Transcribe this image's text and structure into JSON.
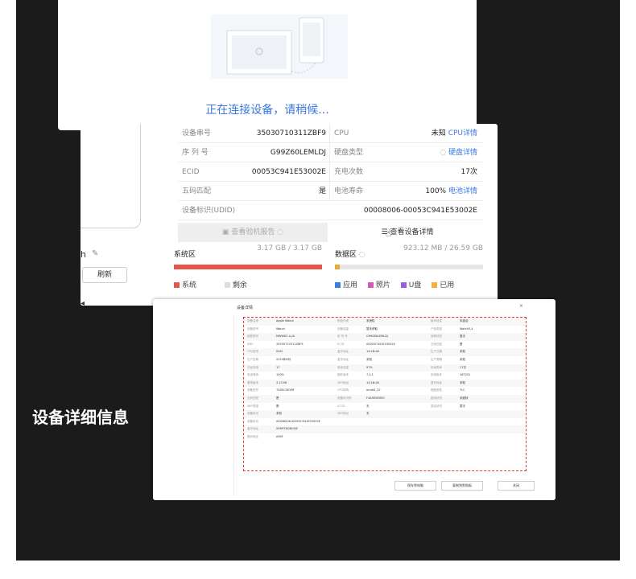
{
  "connect": {
    "text": "正在连接设备，请稍候..."
  },
  "info": {
    "rows": [
      {
        "k1": "设备串号",
        "v1": "35030710311ZBF9",
        "k2": "CPU",
        "v2": "未知",
        "v2_link": "CPU详情"
      },
      {
        "k1": "序 列 号",
        "v1": "G99Z60LEMLDJ",
        "k2": "硬盘类型",
        "v2": "",
        "v2_link": "硬盘详情"
      },
      {
        "k1": "ECID",
        "v1": "00053C941E53002E",
        "k2": "充电次数",
        "v2": "17次",
        "v2_link": ""
      },
      {
        "k1": "五码匹配",
        "v1": "是",
        "k2": "电池寿命",
        "v2": "100%",
        "v2_link": "电池详情"
      }
    ],
    "udid_label": "设备标识(UDID)",
    "udid_value": "00008006-00053C941E53002E",
    "report_button": "查看验机报告",
    "detail_button": "查看设备详情"
  },
  "left": {
    "h": "h",
    "refresh": "刷新"
  },
  "storage": {
    "system": {
      "title": "系统区",
      "value": "3.17 GB / 3.17 GB",
      "fill": 1.0,
      "legend": [
        "系统",
        "剩余"
      ]
    },
    "data": {
      "title": "数据区",
      "value": "923.12 MB / 26.59 GB",
      "fill": 0.035,
      "legend": [
        "应用",
        "照片",
        "U盘",
        "已用"
      ]
    }
  },
  "colors": {
    "system_fill": "#e8554a",
    "data_fill": "#e8a93a",
    "legend_system": "#e8554a",
    "legend_free": "#dddddd",
    "legend_app": "#3a7ee0",
    "legend_photo": "#d05ab5",
    "legend_udisk": "#9c5de0",
    "legend_used": "#f2b13a",
    "link": "#3a78e0"
  },
  "dialog": {
    "title": "设备详情",
    "close": "×",
    "rows": [
      [
        "设备名称",
        "Apple Watch",
        "颜色外壳",
        "未授权",
        "版本信息",
        "未激活"
      ],
      [
        "设备型号",
        "Watch",
        "设备容量",
        "暂未获取",
        "产品类型",
        "Watch5,4"
      ],
      [
        "销售型号",
        "MWWK2 LL/A",
        "序 列 号",
        "G99Z60LEMLDJ",
        "保修状态",
        "暂无"
      ],
      [
        "IMEI",
        "35530710311ZBF9",
        "ECID",
        "00053C941E53002E",
        "五码匹配",
        "是"
      ],
      [
        "CPU型号",
        "S4SI",
        "蓝牙地址",
        "14:1B:A0",
        "生产日期",
        "未知"
      ],
      [
        "生产日期",
        "2019年8月",
        "蓝牙地址",
        "未知",
        "生产周期",
        "未知"
      ],
      [
        "已经充电",
        "17",
        "电池容量",
        "97%",
        "电池寿命",
        "17次"
      ],
      [
        "电池寿命",
        "100%",
        "固件版本",
        "7.4.1",
        "系统版本",
        "18T201"
      ],
      [
        "基带版本",
        "3.13.06",
        "WiFi地址",
        "14:1B:A0",
        "蓝牙地址",
        "未知"
      ],
      [
        "设备型号",
        "74D5C0E5BF",
        "CPU架构",
        "arm64_32",
        "硬盘类型",
        "TLC"
      ],
      [
        "五码匹配",
        "是",
        "设备标识码",
        "F4A9E0D0E0",
        "越狱状态",
        "未越狱"
      ],
      [
        "WiFi类型",
        "是",
        "ICCID",
        "无",
        "激活状态",
        "暂无"
      ],
      [
        "设备标识",
        "未知",
        "WiFi地址",
        "无",
        "",
        ""
      ],
      [
        "设备标识",
        "00008006-00053C941E53002E",
        "",
        "",
        "",
        ""
      ],
      [
        "蓝牙地址",
        "55MP1KD8UQ6",
        "",
        "",
        "",
        ""
      ],
      [
        "数码验证",
        "eSIM",
        "",
        "",
        "",
        ""
      ]
    ],
    "buttons": [
      "保存到电脑",
      "复制到剪贴板",
      "关闭"
    ]
  },
  "caption": "设备详细信息"
}
